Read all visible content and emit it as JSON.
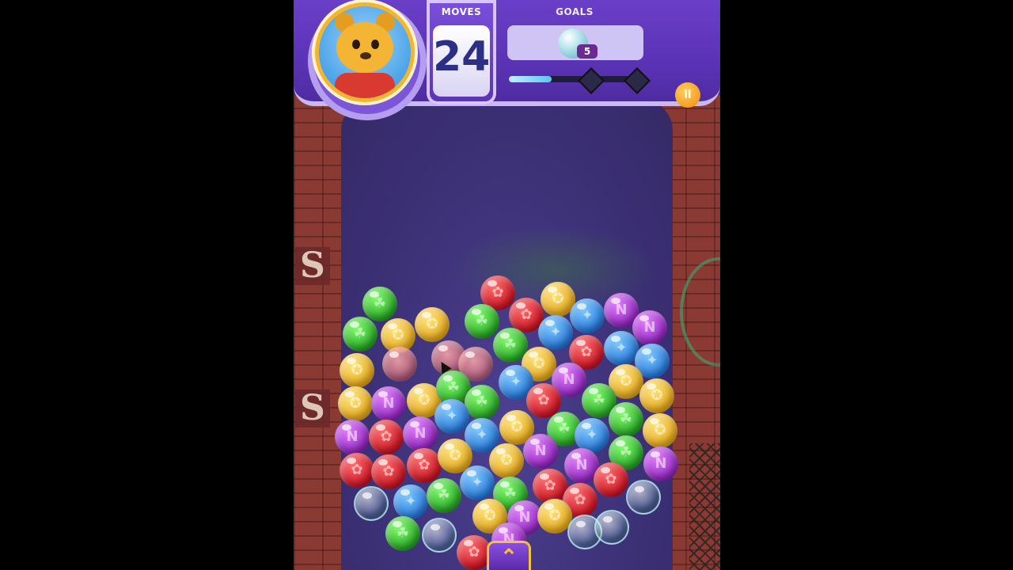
{
  "hud": {
    "moves_label": "MOVES",
    "moves_value": "24",
    "goals_label": "GOALS",
    "goal_count": "5",
    "goal_icon": "clear-bubble-icon",
    "progress_fraction": 0.32,
    "pause_icon": "pause-icon",
    "pause_symbol": "II"
  },
  "graffiti": {
    "top": "S",
    "bottom": "S"
  },
  "launcher": {
    "icon": "chevron-up-icon",
    "symbol": "⌃"
  },
  "colors": {
    "red": "#d61a2a",
    "green": "#2fb52a",
    "blue": "#2a86e6",
    "yellow": "#f0b522",
    "purple": "#a12fd6",
    "accent": "#f3c43a"
  }
}
